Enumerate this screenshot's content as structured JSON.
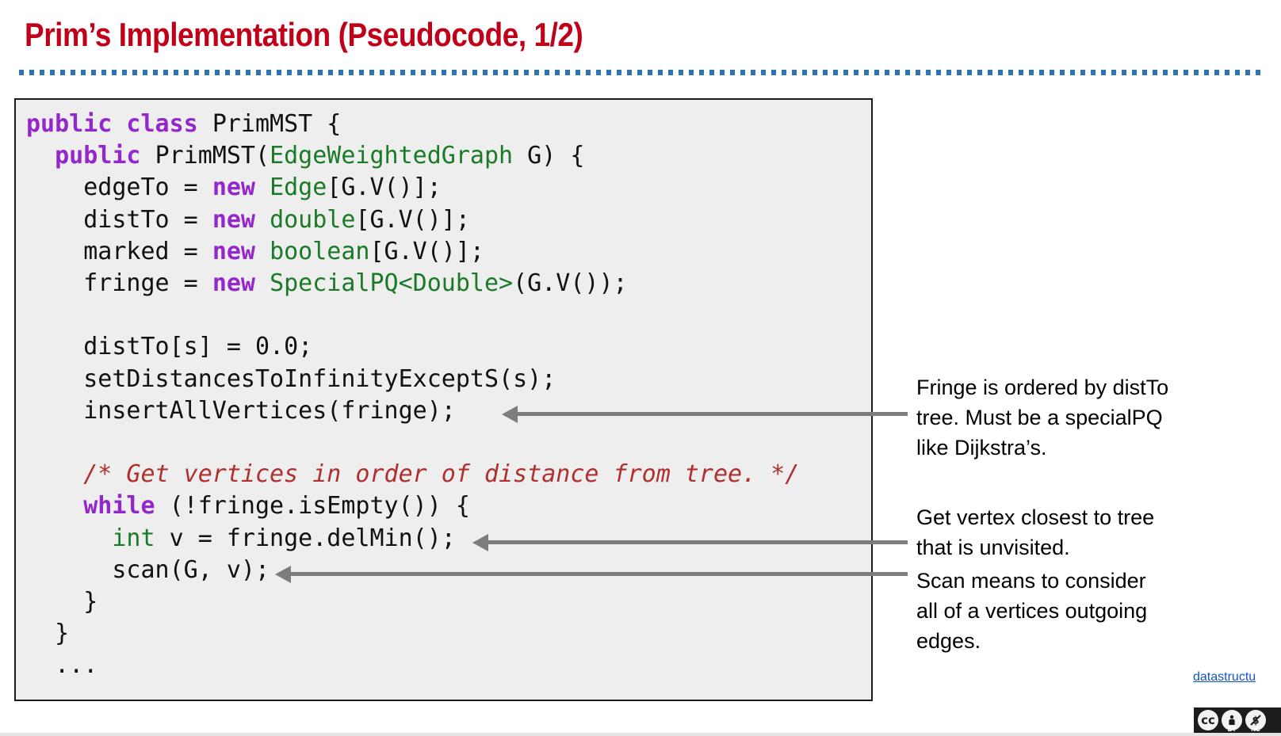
{
  "slide": {
    "title": "Prim’s Implementation (Pseudocode, 1/2)",
    "title_color": "#c00018",
    "rule_color": "#2e74b5",
    "background": "#ffffff"
  },
  "code_block": {
    "background": "#eeeeee",
    "border_color": "#1a1a1a",
    "keyword_color": "#9327cc",
    "type_color": "#1a7a26",
    "comment_color": "#b03030",
    "plain_color": "#111111",
    "lines": [
      "public class PrimMST {",
      "  public PrimMST(EdgeWeightedGraph G) {",
      "    edgeTo = new Edge[G.V()];",
      "    distTo = new double[G.V()];",
      "    marked = new boolean[G.V()];",
      "    fringe = new SpecialPQ<Double>(G.V());",
      "",
      "    distTo[s] = 0.0;",
      "    setDistancesToInfinityExceptS(s);",
      "    insertAllVertices(fringe);",
      "",
      "    /* Get vertices in order of distance from tree. */",
      "    while (!fringe.isEmpty()) {",
      "      int v = fringe.delMin();",
      "      scan(G, v);",
      "    }",
      "  }",
      "  ...",
      ""
    ]
  },
  "annotations": [
    {
      "id": "fringe-note",
      "text": "Fringe is ordered by distTo\ntree. Must be a specialPQ\nlike Dijkstra’s."
    },
    {
      "id": "delmin-note",
      "text": "Get vertex closest to tree\nthat is unvisited."
    },
    {
      "id": "scan-note",
      "text": "Scan means to consider\nall of a vertices outgoing\nedges."
    }
  ],
  "arrows": {
    "color": "#7d7d7d",
    "count": 3
  },
  "footer": {
    "link_text": "datastructu",
    "link_color": "#1155cc",
    "license": {
      "cc": "cc",
      "by_symbol": "\u0000",
      "by_label": "BY",
      "nc_label": "NC"
    }
  }
}
